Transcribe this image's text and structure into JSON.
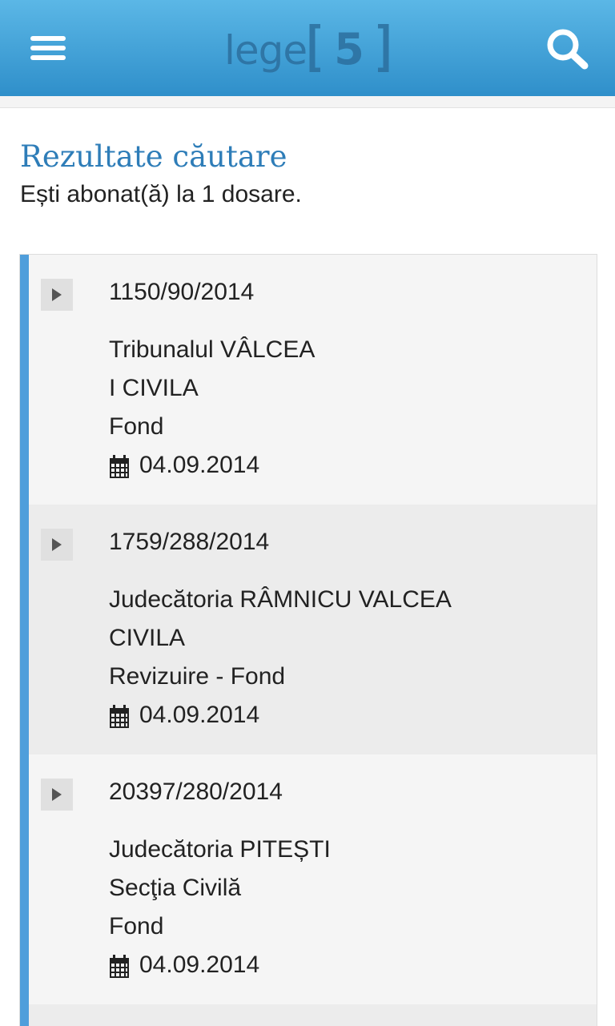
{
  "header": {
    "menu_icon": "hamburger-menu-icon",
    "logo_text": "lege",
    "logo_number": "5",
    "search_icon": "magnifier-icon",
    "colors": {
      "gradient_top": "#5bb7e6",
      "gradient_bottom": "#2f8fca"
    }
  },
  "page": {
    "title": "Rezultate căutare",
    "subscription_text": "Ești abonat(ă) la 1 dosare."
  },
  "results": [
    {
      "case_number": "1150/90/2014",
      "court": "Tribunalul VÂLCEA",
      "section": "I CIVILA",
      "stage": "Fond",
      "date": "04.09.2014"
    },
    {
      "case_number": "1759/288/2014",
      "court": "Judecătoria RÂMNICU VALCEA",
      "section": "CIVILA",
      "stage": "Revizuire - Fond",
      "date": "04.09.2014"
    },
    {
      "case_number": "20397/280/2014",
      "court": "Judecătoria PITEȘTI",
      "section": "Secţia Civilă",
      "stage": "Fond",
      "date": "04.09.2014"
    }
  ],
  "icons": {
    "expand": "play-arrow-icon",
    "date": "calendar-icon"
  },
  "colors": {
    "accent": "#4f9edb",
    "title": "#2e7db8",
    "row_alt": "#ececec",
    "row_plain": "#f5f5f5"
  }
}
